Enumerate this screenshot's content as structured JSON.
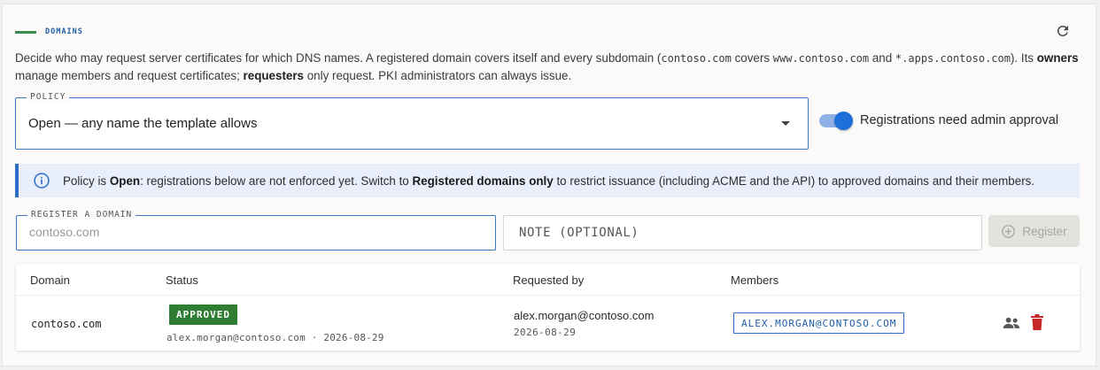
{
  "section": {
    "title": "DOMAINS"
  },
  "description": {
    "p1": "Decide who may request server certificates for which DNS names. A registered domain covers itself and every subdomain (",
    "c1": "contoso.com",
    "p2": " covers ",
    "c2": "www.contoso.com",
    "p3": " and ",
    "c3": "*.apps.contoso.com",
    "p4": "). Its ",
    "b1": "owners",
    "p5": " manage members and request certificates; ",
    "b2": "requesters",
    "p6": " only request. PKI administrators can always issue."
  },
  "policy": {
    "legend": "POLICY",
    "value": "Open — any name the template allows"
  },
  "approval_toggle": {
    "label": "Registrations need admin approval",
    "on": true
  },
  "info_banner": {
    "t1": "Policy is ",
    "b1": "Open",
    "t2": ": registrations below are not enforced yet. Switch to ",
    "b2": "Registered domains only",
    "t3": " to restrict issuance (including ACME and the API) to approved domains and their members."
  },
  "register": {
    "legend": "REGISTER A DOMAIN",
    "placeholder": "contoso.com",
    "note_placeholder": "NOTE (OPTIONAL)",
    "button_label": "Register"
  },
  "table": {
    "headers": {
      "domain": "Domain",
      "status": "Status",
      "requested_by": "Requested by",
      "members": "Members"
    },
    "rows": [
      {
        "domain": "contoso.com",
        "status": "APPROVED",
        "status_meta": "alex.morgan@contoso.com · 2026-08-29",
        "requested_by": "alex.morgan@contoso.com",
        "requested_date": "2026-08-29",
        "member": "ALEX.MORGAN@CONTOSO.COM"
      }
    ]
  },
  "icons": {
    "refresh": "refresh-icon",
    "info": "info-icon",
    "add": "add-circle-icon",
    "members": "group-icon",
    "delete": "trash-icon"
  },
  "colors": {
    "accent": "#1e6fd9",
    "approved": "#2e7d32",
    "delete": "#c62828",
    "info_bg": "#e9effa"
  }
}
